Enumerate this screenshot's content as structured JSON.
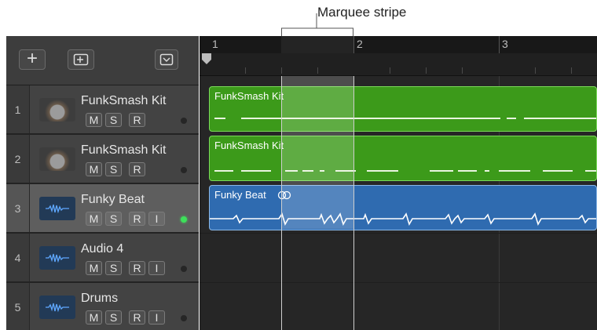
{
  "annotation": {
    "label": "Marquee stripe"
  },
  "toolbar": {
    "add_label": "+",
    "add_icon": "plus-icon",
    "global_icon": "global-tracks-icon",
    "menu_icon": "chevron-down-icon"
  },
  "ruler": {
    "bars": [
      "1",
      "2",
      "3"
    ]
  },
  "tracks": [
    {
      "num": "1",
      "name": "FunkSmash Kit",
      "icon": "drum-kit-icon",
      "buttons": [
        "M",
        "S",
        "R"
      ],
      "led_on": false
    },
    {
      "num": "2",
      "name": "FunkSmash Kit",
      "icon": "drum-kit-icon",
      "buttons": [
        "M",
        "S",
        "R"
      ],
      "led_on": false
    },
    {
      "num": "3",
      "name": "Funky Beat",
      "icon": "audio-waveform-icon",
      "buttons": [
        "M",
        "S",
        "R",
        "I"
      ],
      "led_on": true,
      "selected": true
    },
    {
      "num": "4",
      "name": "Audio 4",
      "icon": "audio-waveform-icon",
      "buttons": [
        "M",
        "S",
        "R",
        "I"
      ],
      "led_on": false
    },
    {
      "num": "5",
      "name": "Drums",
      "icon": "audio-waveform-icon",
      "buttons": [
        "M",
        "S",
        "R",
        "I"
      ],
      "led_on": false
    }
  ],
  "regions": [
    {
      "title": "FunkSmash Kit",
      "color": "#3c9a1a",
      "highlight": "#7ad95a"
    },
    {
      "title": "FunkSmash Kit",
      "color": "#3c9a1a",
      "highlight": "#7ad95a"
    },
    {
      "title": "Funky Beat",
      "color": "#2f6bb0",
      "highlight": "#8ab7e6",
      "loop_icon": "loop-icon"
    }
  ],
  "colors": {
    "accent_green_led": "#3de05a",
    "background_dark": "#262626"
  }
}
